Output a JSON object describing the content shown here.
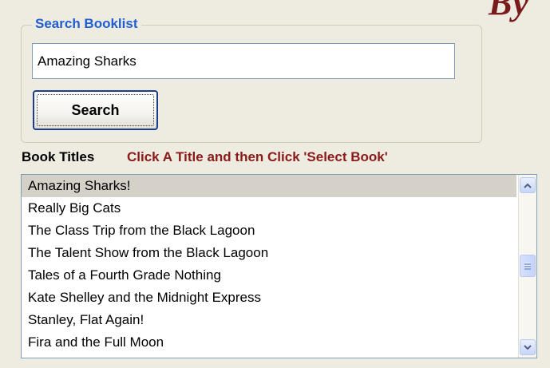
{
  "brand_text": "By",
  "search": {
    "group_title": "Search Booklist",
    "input_value": "Amazing Sharks",
    "button_label": "Search"
  },
  "book_titles": {
    "label": "Book Titles",
    "hint": "Click A Title and then Click 'Select Book'",
    "selected_index": 0,
    "items": [
      {
        "label": "Amazing Sharks!"
      },
      {
        "label": "Really Big Cats"
      },
      {
        "label": "The Class Trip from the Black Lagoon"
      },
      {
        "label": "The Talent Show from the Black Lagoon"
      },
      {
        "label": "Tales of a Fourth Grade Nothing"
      },
      {
        "label": "Kate Shelley and the Midnight Express"
      },
      {
        "label": "Stanley, Flat Again!"
      },
      {
        "label": "Fira and the Full Moon"
      }
    ]
  },
  "icons": {
    "scroll_up": "chevron-up-icon",
    "scroll_down": "chevron-down-icon"
  },
  "colors": {
    "group_title": "#1f5fd1",
    "hint": "#8b1a1a",
    "selected_row": "#d5d0c8",
    "brand": "#7a1b1b"
  }
}
